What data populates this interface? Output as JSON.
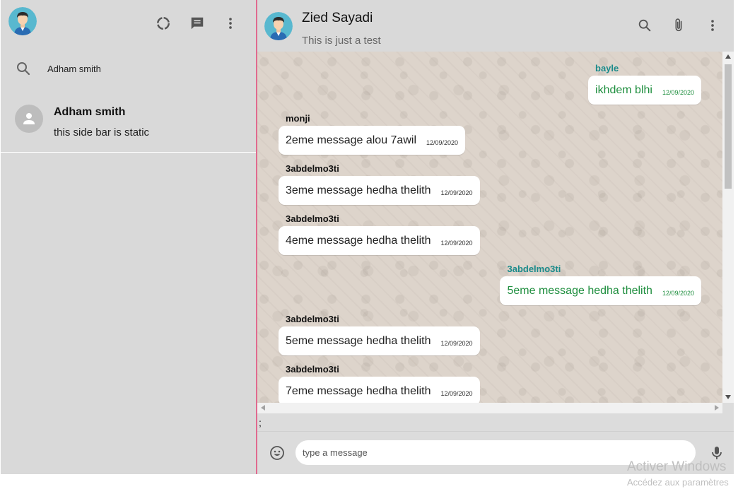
{
  "sidebar": {
    "search": {
      "value": "Adham smith",
      "placeholder": ""
    },
    "chats": [
      {
        "name": "Adham smith",
        "preview": "this side bar is static"
      }
    ]
  },
  "chat": {
    "title": "Zied Sayadi",
    "subtitle": "This is just a test",
    "messages": [
      {
        "sender": "bayle",
        "text": "ikhdem blhi",
        "time": "12/09/2020",
        "direction": "outgoing"
      },
      {
        "sender": "monji",
        "text": "2eme message alou 7awil",
        "time": "12/09/2020",
        "direction": "incoming"
      },
      {
        "sender": "3abdelmo3ti",
        "text": "3eme message hedha thelith",
        "time": "12/09/2020",
        "direction": "incoming"
      },
      {
        "sender": "3abdelmo3ti",
        "text": "4eme message hedha thelith",
        "time": "12/09/2020",
        "direction": "incoming"
      },
      {
        "sender": "3abdelmo3ti",
        "text": "5eme message hedha thelith",
        "time": "12/09/2020",
        "direction": "outgoing"
      },
      {
        "sender": "3abdelmo3ti",
        "text": "5eme message hedha thelith",
        "time": "12/09/2020",
        "direction": "incoming"
      },
      {
        "sender": "3abdelmo3ti",
        "text": "7eme message hedha thelith",
        "time": "12/09/2020",
        "direction": "incoming"
      }
    ],
    "stray_text": ";",
    "composer": {
      "placeholder": "type a message",
      "value": ""
    }
  },
  "icons": {
    "sidebar_header": [
      "status-icon",
      "new-chat-icon",
      "more-vert-icon"
    ],
    "chat_header": [
      "search-icon",
      "attach-icon",
      "more-vert-icon"
    ],
    "composer": [
      "emoji-icon",
      "mic-icon"
    ]
  },
  "colors": {
    "sidebar_bg": "#d9d9d9",
    "chat_bg": "#ddd4cb",
    "header_accent": "#e06a8f",
    "outgoing_sender": "#1a8a8a",
    "outgoing_text": "#1e8e3e"
  },
  "watermark": {
    "title": "Activer Windows",
    "subtitle": "Accédez aux paramètres"
  }
}
